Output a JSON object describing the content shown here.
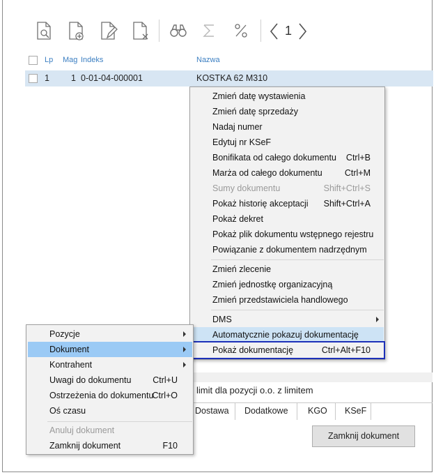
{
  "toolbar": {
    "buttons": [
      {
        "icon": "document-preview-icon"
      },
      {
        "icon": "document-add-icon"
      },
      {
        "icon": "document-edit-icon"
      },
      {
        "icon": "document-delete-icon"
      },
      {
        "icon": "binoculars-icon"
      },
      {
        "icon": "sigma-icon"
      },
      {
        "icon": "percent-icon"
      }
    ],
    "page_number": "1"
  },
  "table": {
    "headers": {
      "lp": "Lp",
      "mag": "Mag",
      "indeks": "Indeks",
      "nazwa": "Nazwa"
    },
    "rows": [
      {
        "lp": "1",
        "mag": "1",
        "indeks": "0-01-04-000001",
        "nazwa": "KOSTKA 62 M310"
      }
    ]
  },
  "context_menu": {
    "items": [
      {
        "label": "Zmień datę wystawienia",
        "shortcut": ""
      },
      {
        "label": "Zmień datę sprzedaży",
        "shortcut": ""
      },
      {
        "label": "Nadaj numer",
        "shortcut": ""
      },
      {
        "label": "Edytuj nr KSeF",
        "shortcut": ""
      },
      {
        "label": "Bonifikata od całego dokumentu",
        "shortcut": "Ctrl+B"
      },
      {
        "label": "Marża od całego dokumentu",
        "shortcut": "Ctrl+M"
      },
      {
        "label": "Sumy dokumentu",
        "shortcut": "Shift+Ctrl+S"
      },
      {
        "label": "Pokaż historię akceptacji",
        "shortcut": "Shift+Ctrl+A"
      },
      {
        "label": "Pokaż dekret",
        "shortcut": ""
      },
      {
        "label": "Pokaż plik dokumentu wstępnego rejestru",
        "shortcut": ""
      },
      {
        "label": "Powiązanie z dokumentem nadrzędnym",
        "shortcut": ""
      },
      {
        "label": "Zmień zlecenie",
        "shortcut": ""
      },
      {
        "label": "Zmień jednostkę organizacyjną",
        "shortcut": ""
      },
      {
        "label": "Zmień przedstawiciela handlowego",
        "shortcut": ""
      },
      {
        "label": "DMS",
        "shortcut": ""
      },
      {
        "label": "Automatycznie pokazuj dokumentację",
        "shortcut": ""
      },
      {
        "label": "Pokaż dokumentację",
        "shortcut": "Ctrl+Alt+F10"
      }
    ]
  },
  "left_menu": {
    "items": [
      {
        "label": "Pozycje",
        "shortcut": ""
      },
      {
        "label": "Dokument",
        "shortcut": ""
      },
      {
        "label": "Kontrahent",
        "shortcut": ""
      },
      {
        "label": "Uwagi do dokumentu",
        "shortcut": "Ctrl+U"
      },
      {
        "label": "Ostrzeżenia do dokumentu",
        "shortcut": "Ctrl+O"
      },
      {
        "label": "Oś czasu",
        "shortcut": ""
      },
      {
        "label": "Anuluj dokument",
        "shortcut": ""
      },
      {
        "label": "Zamknij dokument",
        "shortcut": "F10"
      }
    ]
  },
  "bottom": {
    "limit_text": "limit dla pozycji o.o. z limitem",
    "tabs": [
      "Dostawa",
      "Dodatkowe",
      "KGO",
      "KSeF"
    ],
    "close_button": "Zamknij dokument"
  }
}
